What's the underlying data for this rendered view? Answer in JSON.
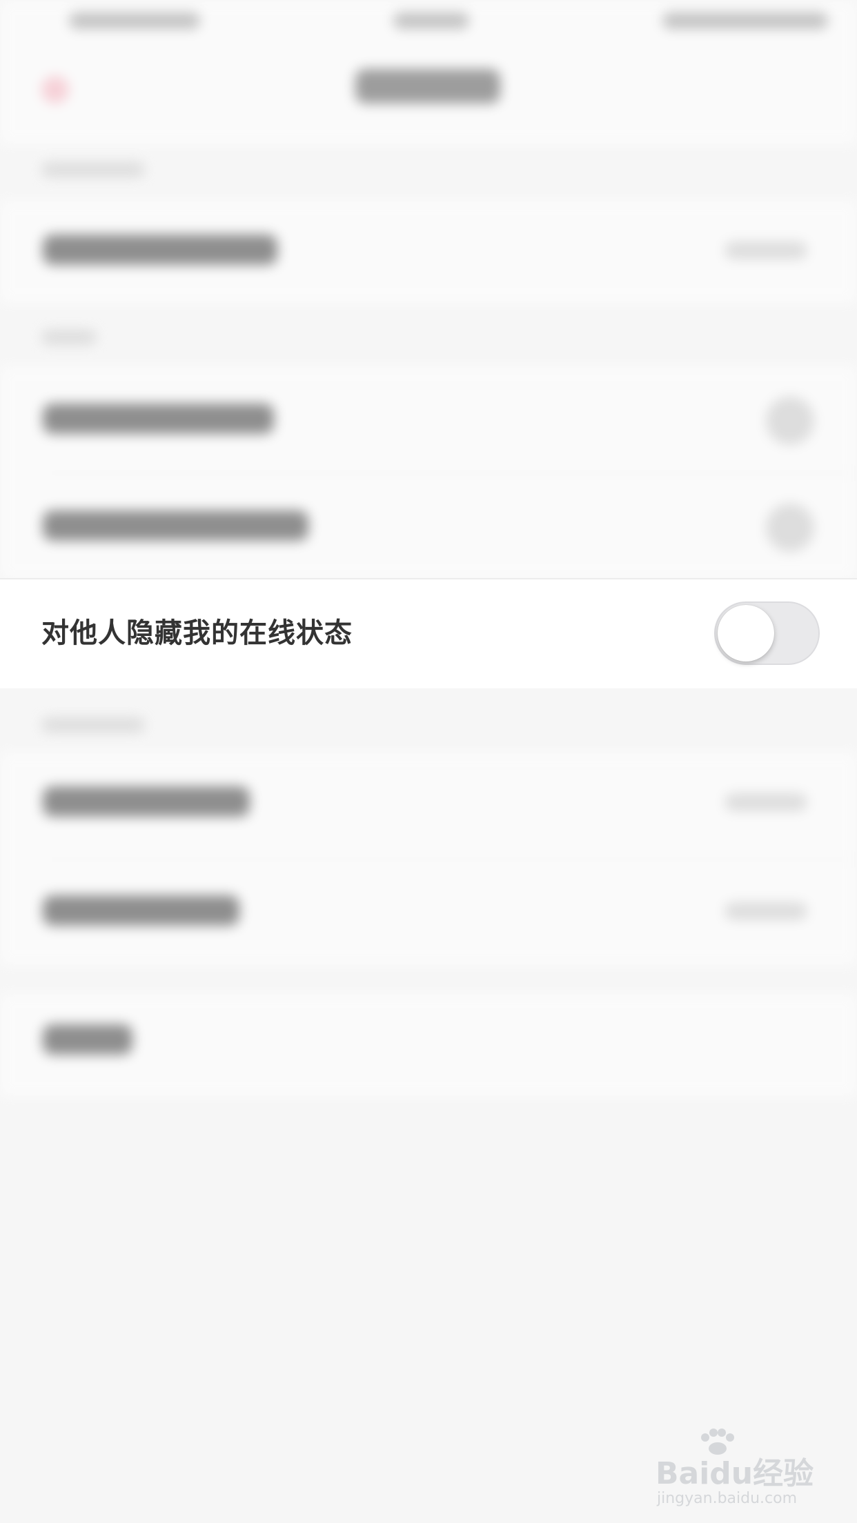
{
  "settings": {
    "hide_online_status_label": "对他人隐藏我的在线状态",
    "hide_online_status_enabled": false
  },
  "watermark": {
    "brand": "Baidu经验",
    "url": "jingyan.baidu.com"
  },
  "colors": {
    "toggle_off_track": "#e9e9eb",
    "label_text": "#333333",
    "back_icon_accent": "#f7b3bf"
  },
  "icons": {
    "back": "back-arrow-icon",
    "watermark_logo": "baidu-paw-icon"
  }
}
